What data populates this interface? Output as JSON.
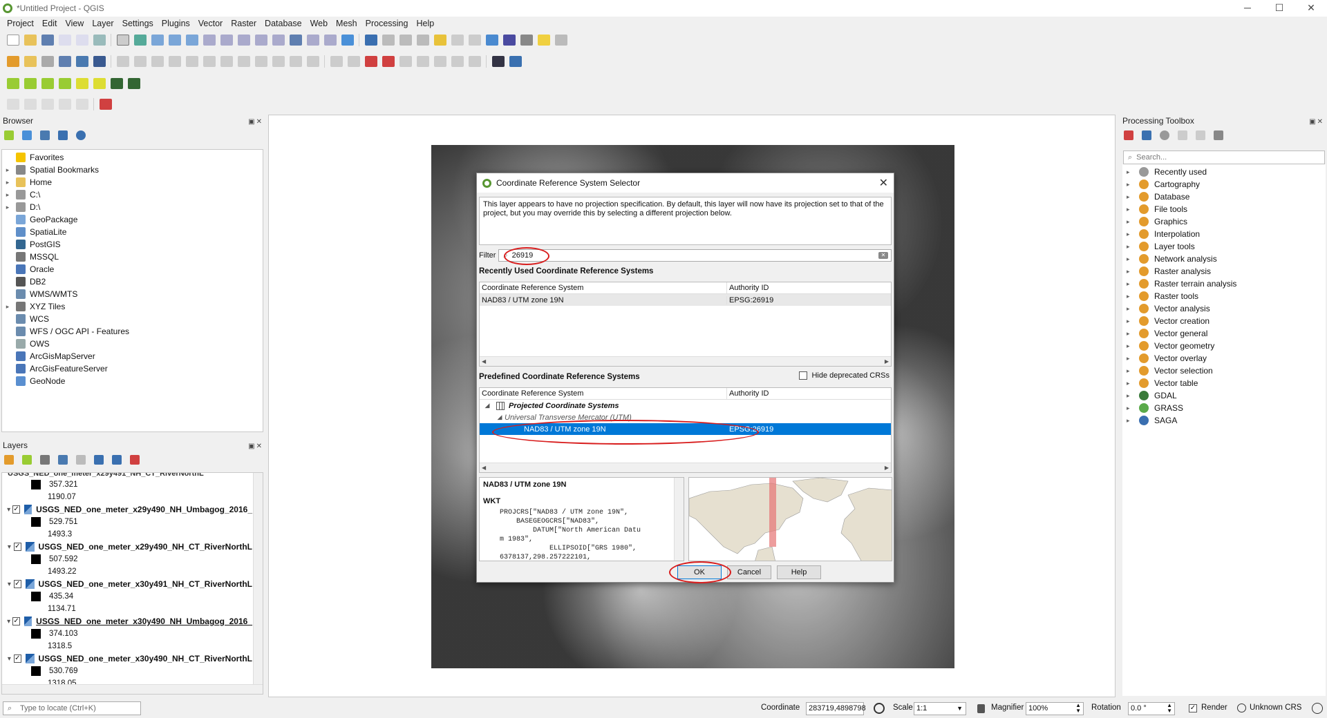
{
  "window": {
    "title": "*Untitled Project - QGIS",
    "controls": [
      "─",
      "☐",
      "✕"
    ]
  },
  "menubar": [
    "Project",
    "Edit",
    "View",
    "Layer",
    "Settings",
    "Plugins",
    "Vector",
    "Raster",
    "Database",
    "Web",
    "Mesh",
    "Processing",
    "Help"
  ],
  "browser": {
    "title": "Browser",
    "items": [
      {
        "label": "Favorites",
        "icon": "star-icon",
        "arrow": "",
        "color": "#f5c400"
      },
      {
        "label": "Spatial Bookmarks",
        "icon": "bookmark-icon",
        "arrow": "▸",
        "color": "#888"
      },
      {
        "label": "Home",
        "icon": "folder-icon",
        "arrow": "▸",
        "color": "#e8c25a"
      },
      {
        "label": "C:\\",
        "icon": "drive-icon",
        "arrow": "▸",
        "color": "#999"
      },
      {
        "label": "D:\\",
        "icon": "drive-icon",
        "arrow": "▸",
        "color": "#999"
      },
      {
        "label": "GeoPackage",
        "icon": "geopackage-icon",
        "arrow": "",
        "color": "#7aa6d8"
      },
      {
        "label": "SpatiaLite",
        "icon": "spatialite-icon",
        "arrow": "",
        "color": "#5f8fc9"
      },
      {
        "label": "PostGIS",
        "icon": "postgis-icon",
        "arrow": "",
        "color": "#336791"
      },
      {
        "label": "MSSQL",
        "icon": "mssql-icon",
        "arrow": "",
        "color": "#777"
      },
      {
        "label": "Oracle",
        "icon": "oracle-icon",
        "arrow": "",
        "color": "#4a76b8"
      },
      {
        "label": "DB2",
        "icon": "db2-icon",
        "arrow": "",
        "color": "#555"
      },
      {
        "label": "WMS/WMTS",
        "icon": "globe-icon",
        "arrow": "",
        "color": "#6b8cae"
      },
      {
        "label": "XYZ Tiles",
        "icon": "grid-icon",
        "arrow": "▸",
        "color": "#777"
      },
      {
        "label": "WCS",
        "icon": "globe-icon",
        "arrow": "",
        "color": "#6b8cae"
      },
      {
        "label": "WFS / OGC API - Features",
        "icon": "globe-icon",
        "arrow": "",
        "color": "#6b8cae"
      },
      {
        "label": "OWS",
        "icon": "globe-icon",
        "arrow": "",
        "color": "#9aa"
      },
      {
        "label": "ArcGisMapServer",
        "icon": "arcgis-icon",
        "arrow": "",
        "color": "#4a76b8"
      },
      {
        "label": "ArcGisFeatureServer",
        "icon": "arcgis-icon",
        "arrow": "",
        "color": "#4a76b8"
      },
      {
        "label": "GeoNode",
        "icon": "geonode-icon",
        "arrow": "",
        "color": "#5a8fd0"
      }
    ]
  },
  "layers": {
    "title": "Layers",
    "top_partial": {
      "name": "USGS_NED_one_meter_x29y491_NH_CT_RiverNorthL",
      "min": "357.321",
      "max": "1190.07"
    },
    "items": [
      {
        "name": "USGS_NED_one_meter_x29y490_NH_Umbagog_2016_",
        "min": "529.751",
        "max": "1493.3",
        "checked": "✓"
      },
      {
        "name": "USGS_NED_one_meter_x29y490_NH_CT_RiverNorthL",
        "min": "507.592",
        "max": "1493.22",
        "checked": "✓"
      },
      {
        "name": "USGS_NED_one_meter_x30y491_NH_CT_RiverNorthL",
        "min": "435.34",
        "max": "1134.71",
        "checked": "✓"
      },
      {
        "name": "USGS_NED_one_meter_x30y490_NH_Umbagog_2016_",
        "min": "374.103",
        "max": "1318.5",
        "checked": "✓"
      },
      {
        "name": "USGS_NED_one_meter_x30y490_NH_CT_RiverNorthL",
        "min": "530.769",
        "max": "1318.05",
        "checked": "✓"
      }
    ]
  },
  "dialog": {
    "title": "Coordinate Reference System Selector",
    "message": "This layer appears to have no projection specification. By default, this layer will now have its projection set to that of the project, but you may override this by selecting a different projection below.",
    "filter_label": "Filter",
    "filter_value": "26919",
    "recent_title": "Recently Used Coordinate Reference Systems",
    "col_crs": "Coordinate Reference System",
    "col_auth": "Authority ID",
    "recent_rows": [
      {
        "crs": "NAD83 / UTM zone 19N",
        "auth": "EPSG:26919"
      }
    ],
    "predefined_title": "Predefined Coordinate Reference Systems",
    "hide_deprecated": "Hide deprecated CRSs",
    "tree_group": "Projected Coordinate Systems",
    "tree_sub": "Universal Transverse Mercator (UTM)",
    "selected_crs": "NAD83 / UTM zone 19N",
    "selected_auth": "EPSG:26919",
    "wkt_title": "NAD83 / UTM zone 19N",
    "wkt_head": "WKT",
    "wkt_code": "    PROJCRS[\"NAD83 / UTM zone 19N\",\n        BASEGEOGCRS[\"NAD83\",\n            DATUM[\"North American Datu\n    m 1983\",\n                ELLIPSOID[\"GRS 1980\",\n    6378137,298.257222101,",
    "ok": "OK",
    "cancel": "Cancel",
    "help": "Help"
  },
  "processing": {
    "title": "Processing Toolbox",
    "search_placeholder": "Search...",
    "items": [
      {
        "label": "Recently used",
        "color": "#999"
      },
      {
        "label": "Cartography",
        "color": "#e39b2c"
      },
      {
        "label": "Database",
        "color": "#e39b2c"
      },
      {
        "label": "File tools",
        "color": "#e39b2c"
      },
      {
        "label": "Graphics",
        "color": "#e39b2c"
      },
      {
        "label": "Interpolation",
        "color": "#e39b2c"
      },
      {
        "label": "Layer tools",
        "color": "#e39b2c"
      },
      {
        "label": "Network analysis",
        "color": "#e39b2c"
      },
      {
        "label": "Raster analysis",
        "color": "#e39b2c"
      },
      {
        "label": "Raster terrain analysis",
        "color": "#e39b2c"
      },
      {
        "label": "Raster tools",
        "color": "#e39b2c"
      },
      {
        "label": "Vector analysis",
        "color": "#e39b2c"
      },
      {
        "label": "Vector creation",
        "color": "#e39b2c"
      },
      {
        "label": "Vector general",
        "color": "#e39b2c"
      },
      {
        "label": "Vector geometry",
        "color": "#e39b2c"
      },
      {
        "label": "Vector overlay",
        "color": "#e39b2c"
      },
      {
        "label": "Vector selection",
        "color": "#e39b2c"
      },
      {
        "label": "Vector table",
        "color": "#e39b2c"
      },
      {
        "label": "GDAL",
        "color": "#3a7a3a"
      },
      {
        "label": "GRASS",
        "color": "#5aaa4a"
      },
      {
        "label": "SAGA",
        "color": "#3a6fb0"
      }
    ]
  },
  "statusbar": {
    "locate_placeholder": "Type to locate (Ctrl+K)",
    "coordinate_label": "Coordinate",
    "coordinate_value": "283719,4898798",
    "scale_label": "Scale",
    "scale_value": "1:1",
    "magnifier_label": "Magnifier",
    "magnifier_value": "100%",
    "rotation_label": "Rotation",
    "rotation_value": "0.0 °",
    "render_label": "Render",
    "crs_label": "Unknown CRS"
  },
  "colors": {
    "accent": "#0078d7",
    "highlight": "#d81c1c",
    "qgis_green": "#589632"
  }
}
